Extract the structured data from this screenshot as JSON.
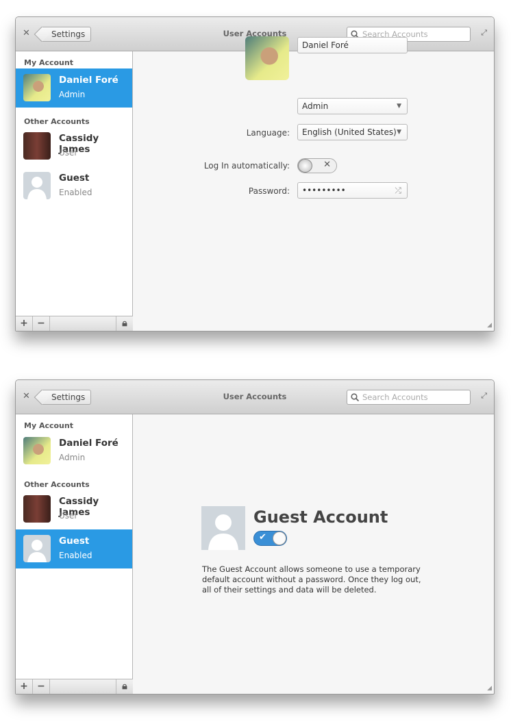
{
  "header": {
    "close_icon": "close-icon",
    "back_label": "Settings",
    "title": "User Accounts",
    "search_placeholder": "Search Accounts",
    "maximize_icon": "maximize-icon"
  },
  "sidebar": {
    "my_account_heading": "My Account",
    "other_accounts_heading": "Other Accounts",
    "accounts": [
      {
        "name": "Daniel Foré",
        "role": "Admin"
      },
      {
        "name": "Cassidy James",
        "role": "User"
      },
      {
        "name": "Guest",
        "role": "Enabled"
      }
    ],
    "add_label": "+",
    "remove_label": "−",
    "lock_icon": "lock-icon"
  },
  "selection_color": "#2a9ae4",
  "detail": {
    "full_name": "Daniel Foré",
    "account_type": "Admin",
    "language_label": "Language:",
    "language": "English (United States)",
    "autologin_label": "Log In automatically:",
    "autologin_on": false,
    "password_label": "Password:",
    "password": "•••••••••"
  },
  "guest": {
    "title": "Guest Account",
    "enabled": true,
    "description": "The Guest Account allows someone to use a temporary default account without a password. Once they log out, all of their settings and data will be deleted."
  }
}
